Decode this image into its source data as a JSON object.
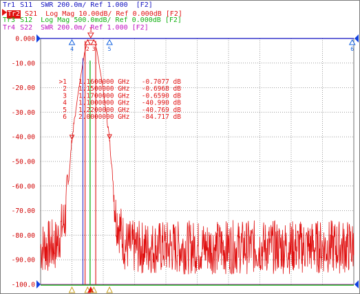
{
  "traces": [
    {
      "tag": "Tr1",
      "text": " S11  SWR 200.0m/ Ref 1.000  [F2]",
      "color": "#1010c0"
    },
    {
      "tag": "Tr2",
      "text": " S21  Log Mag 10.00dB/ Ref 0.000dB [F2]",
      "color": "#e01010"
    },
    {
      "tag": "Tr3",
      "text": " S12  Log Mag 500.0mdB/ Ref 0.000dB [F2]",
      "color": "#10b010"
    },
    {
      "tag": "Tr4",
      "text": " S22  SWR 200.0m/ Ref 1.000 [F2]",
      "color": "#c010c0"
    }
  ],
  "y_tick_labels": [
    "0.000",
    "-10.00",
    "-20.00",
    "-30.00",
    "-40.00",
    "-50.00",
    "-60.00",
    "-70.00",
    "-80.00",
    "-90.00",
    "-100.0"
  ],
  "markers": [
    {
      "id": ">1",
      "freq": "1.1600000 GHz",
      "value": "-0.7077 dB"
    },
    {
      "id": "2",
      "freq": "1.1500000 GHz",
      "value": "-0.6968 dB"
    },
    {
      "id": "3",
      "freq": "1.1700000 GHz",
      "value": "-0.6590 dB"
    },
    {
      "id": "4",
      "freq": "1.1000000 GHz",
      "value": "-40.990 dB"
    },
    {
      "id": "5",
      "freq": "1.2200000 GHz",
      "value": "-40.769 dB"
    },
    {
      "id": "6",
      "freq": "2.0000000 GHz",
      "value": "-84.717 dB"
    }
  ],
  "top_marker_labels": {
    "m1": "1",
    "m4": "4",
    "m2": "2",
    "m3": "3",
    "m5": "5",
    "m6": "6"
  },
  "colors": {
    "s21": "#e01010",
    "s12": "#10b010",
    "s11": "#1010c0",
    "s22": "#c010c0",
    "grid": "#9a9a9a",
    "axis_text": "#d00000"
  },
  "chart_data": {
    "type": "line",
    "ylabel": "",
    "ylim": [
      -100,
      0
    ],
    "y_divisions": 10,
    "grid": true,
    "series": [
      {
        "name": "S21",
        "units": "dB",
        "x_ghz": [
          1.0,
          1.05,
          1.08,
          1.1,
          1.12,
          1.14,
          1.15,
          1.16,
          1.17,
          1.18,
          1.2,
          1.22,
          1.24,
          1.27,
          1.3,
          2.0
        ],
        "y_db": [
          -85,
          -84,
          -72,
          -41,
          -22,
          -6,
          -0.7,
          -0.71,
          -0.66,
          -5,
          -21,
          -40.8,
          -72,
          -84,
          -85,
          -84.7
        ]
      }
    ]
  }
}
